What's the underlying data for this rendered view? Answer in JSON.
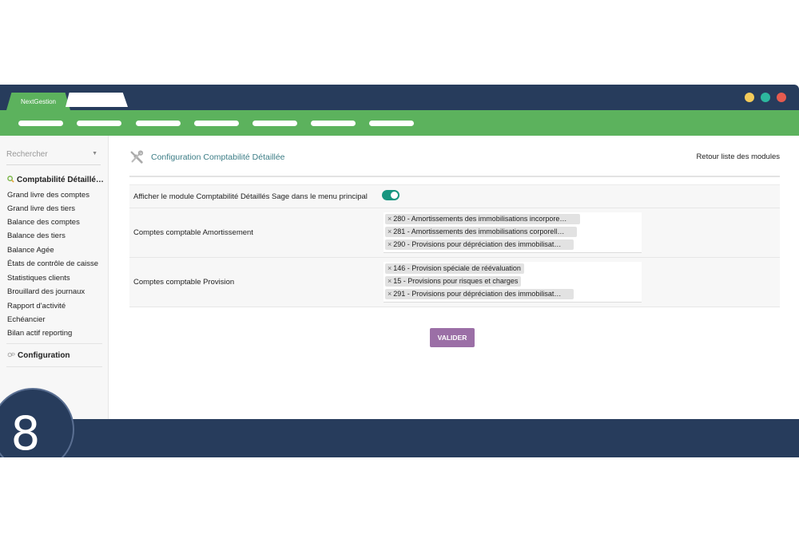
{
  "window": {
    "tab_active_label": "NextGestion",
    "traffic_lights": [
      "#f4cb5a",
      "#2db89e",
      "#e65b4f"
    ],
    "nav_pill_count": 7
  },
  "colors": {
    "header_bg": "#273c5c",
    "nav_green": "#5cb25d",
    "accent_teal": "#3c7d86",
    "button_purple": "#9b6fa6",
    "toggle_on": "#17957f"
  },
  "sidebar": {
    "search_placeholder": "Rechercher",
    "section_title": "Comptabilité Détaillé…",
    "items": [
      {
        "label": "Grand livre des comptes"
      },
      {
        "label": "Grand livre des tiers"
      },
      {
        "label": "Balance des comptes"
      },
      {
        "label": "Balance des tiers"
      },
      {
        "label": "Balance Agée"
      },
      {
        "label": "États de contrôle de caisse"
      },
      {
        "label": "Statistiques clients"
      },
      {
        "label": "Brouillard des journaux"
      },
      {
        "label": "Rapport d'activité"
      },
      {
        "label": "Echéancier"
      },
      {
        "label": "Bilan actif reporting"
      }
    ],
    "config_title": "Configuration"
  },
  "main": {
    "title": "Configuration Comptabilité Détaillée",
    "back_link": "Retour liste des modules",
    "settings": {
      "toggle_label": "Afficher le module Comptabilité Détaillés Sage dans le menu principal",
      "toggle_on": true,
      "amortissement": {
        "label": "Comptes comptable Amortissement",
        "tags": [
          "280 - Amortissements des immobilisations incorpore…",
          "281 - Amortissements des immobilisations corporell…",
          "290 - Provisions pour dépréciation des immobilisat…"
        ]
      },
      "provision": {
        "label": "Comptes comptable Provision",
        "tags": [
          "146 - Provision spéciale de réévaluation",
          "15 - Provisions pour risques et charges",
          "291 - Provisions pour dépréciation des immobilisat…"
        ]
      }
    },
    "submit_label": "VALIDER"
  },
  "step_badge": "8"
}
